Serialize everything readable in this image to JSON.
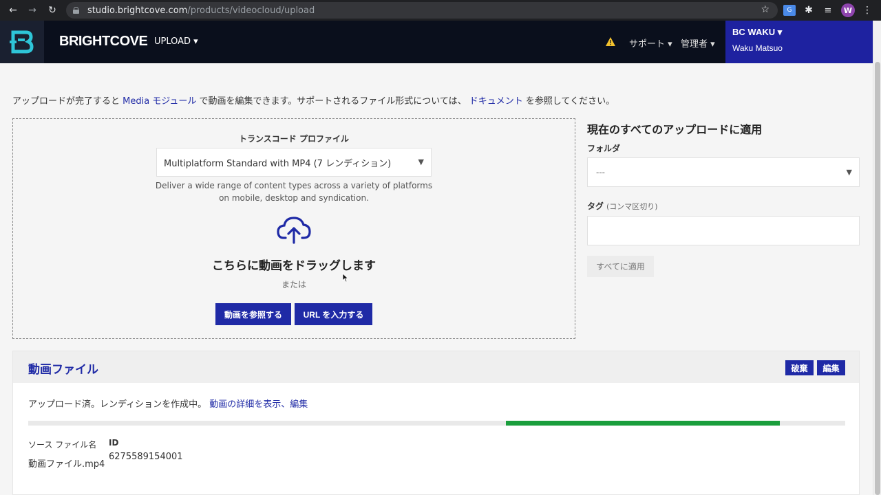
{
  "browser": {
    "url_host": "studio.brightcove.com",
    "url_path": "/products/videocloud/upload",
    "back_icon": "←",
    "forward_icon": "→",
    "reload_icon": "↻",
    "star_icon": "☆",
    "translate_label": "G",
    "puzzle_icon": "✱",
    "media_icon": "≡",
    "profile_initial": "W",
    "menu_icon": "⋮"
  },
  "header": {
    "brand": "BRIGHTCOVE",
    "upload_menu": "UPLOAD ▾",
    "support": "サポート ▾",
    "admin": "管理者 ▾",
    "account_name": "BC WAKU ▾",
    "account_user": "Waku Matsuo"
  },
  "intro": {
    "part1": "アップロードが完了すると ",
    "media_link": "Media モジュール",
    "part2": " で動画を編集できます。サポートされるファイル形式については、 ",
    "doc_link": "ドキュメント",
    "part3": " を参照してください。"
  },
  "dropzone": {
    "profile_label": "トランスコード プロファイル",
    "profile_value": "Multiplatform Standard with MP4 (7 レンディション)",
    "profile_desc": "Deliver a wide range of content types across a variety of platforms on mobile, desktop and syndication.",
    "drag_text": "こちらに動画をドラッグします",
    "or_text": "または",
    "browse_button": "動画を参照する",
    "url_button": "URL を入力する"
  },
  "apply_all": {
    "title": "現在のすべてのアップロードに適用",
    "folder_label": "フォルダ",
    "folder_value": "---",
    "tag_label": "タグ",
    "tag_hint": "(コンマ区切り)",
    "apply_button": "すべてに適用"
  },
  "video_file": {
    "title": "動画ファイル",
    "discard_button": "破棄",
    "edit_button": "編集",
    "status_text": "アップロード済。レンディションを作成中。 ",
    "details_link": "動画の詳細を表示、編集",
    "progress_start": 0.585,
    "progress_end": 0.92,
    "source_label": "ソース ファイル名",
    "id_label": "ID",
    "source_value": "動画ファイル.mp4",
    "id_value": "6275589154001"
  },
  "colors": {
    "brand_blue": "#1f2aa6",
    "account_bg": "#1e22a0",
    "header_bg": "#0a0f1c",
    "progress_green": "#1a9e3c",
    "logo_cyan": "#2ec5d8"
  }
}
